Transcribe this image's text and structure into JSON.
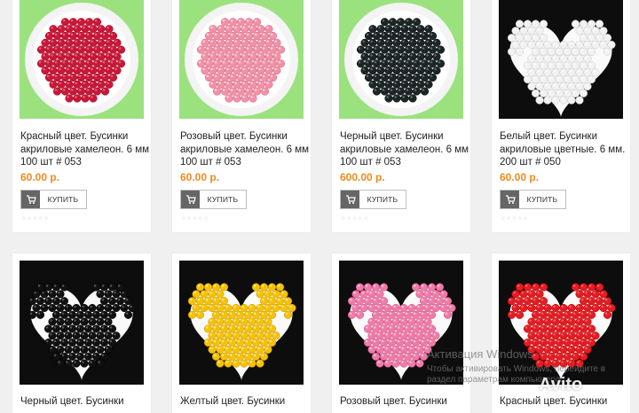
{
  "products": [
    {
      "title": "Красный цвет. Бусинки акриловые хамелеон. 6 мм 100 шт # 053",
      "price": "60.00 р.",
      "buy_label": "КУПИТЬ",
      "rating_stars": "☆☆☆☆☆",
      "rating": 0,
      "background": "#9be27e",
      "shape": "dish",
      "bead_color": "#c8183a"
    },
    {
      "title": "Розовый цвет. Бусинки акриловые хамелеон. 6 мм 100 шт # 053",
      "price": "60.00 р.",
      "buy_label": "КУПИТЬ",
      "rating_stars": "☆☆☆☆☆",
      "rating": 0,
      "background": "#9be27e",
      "shape": "dish",
      "bead_color": "#f490a6"
    },
    {
      "title": "Черный цвет. Бусинки акриловые хамелеон. 6 мм 100 шт # 053",
      "price": "600.00 р.",
      "buy_label": "КУПИТЬ",
      "rating_stars": "☆☆☆☆☆",
      "rating": 0,
      "background": "#9be27e",
      "shape": "dish",
      "bead_color": "#1c2626"
    },
    {
      "title": "Белый цвет. Бусинки акриловые цветные. 6 мм. 200 шт # 050",
      "price": "60.00 р.",
      "buy_label": "КУПИТЬ",
      "rating_stars": "☆☆☆☆☆",
      "rating": 0,
      "background": "#0d0d0d",
      "shape": "heart",
      "bead_color": "#f2f2f2"
    },
    {
      "title": "Черный цвет. Бусинки",
      "background": "#0d0d0d",
      "shape": "heart",
      "bead_color": "#111111"
    },
    {
      "title": "Желтый цвет. Бусинки",
      "background": "#0d0d0d",
      "shape": "heart",
      "bead_color": "#f5c10e"
    },
    {
      "title": "Розовый цвет. Бусинки",
      "background": "#0d0d0d",
      "shape": "heart",
      "bead_color": "#f07aa8"
    },
    {
      "title": "Красный цвет. Бусинки",
      "background": "#0d0d0d",
      "shape": "heart",
      "bead_color": "#e21d24"
    }
  ],
  "watermark": {
    "title": "Активация Windows",
    "subtitle": "Чтобы активировать Windows, перейдите в раздел параметрам компьютера.",
    "logo_text": "Avito"
  },
  "icons": {
    "cart": "cart-icon",
    "star": "star-icon"
  },
  "colors": {
    "price": "#f08a1c",
    "button_icon_bg": "#666666",
    "page_bg": "#f0f0f0"
  }
}
